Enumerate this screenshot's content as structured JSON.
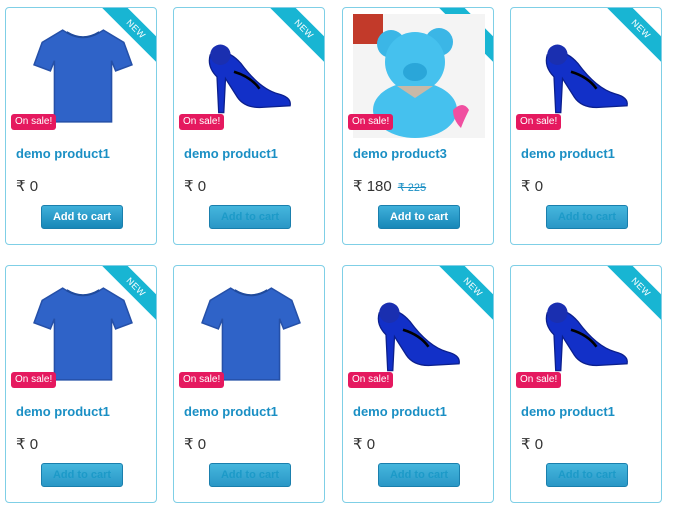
{
  "colors": {
    "accent": "#1a8fc4",
    "sale": "#e5195f",
    "ribbon": "#18b5d3",
    "border": "#7fcfe6"
  },
  "products": [
    {
      "name": "demo product1",
      "price": "₹ 0",
      "old_price": "",
      "badge": "On sale!",
      "ribbon": "NEW",
      "image": "tshirt-icon",
      "button": "Add to cart"
    },
    {
      "name": "demo product1",
      "price": "₹ 0",
      "old_price": "",
      "badge": "On sale!",
      "ribbon": "NEW",
      "image": "heel-icon",
      "button": "Add to cart"
    },
    {
      "name": "demo product3",
      "price": "₹ 180",
      "old_price": "₹ 225",
      "badge": "On sale!",
      "ribbon": "NEW",
      "image": "teddy-icon",
      "button": "Add to cart"
    },
    {
      "name": "demo product1",
      "price": "₹ 0",
      "old_price": "",
      "badge": "On sale!",
      "ribbon": "NEW",
      "image": "heel-icon",
      "button": "Add to cart"
    },
    {
      "name": "demo product1",
      "price": "₹ 0",
      "old_price": "",
      "badge": "On sale!",
      "ribbon": "NEW",
      "image": "tshirt-icon",
      "button": "Add to cart"
    },
    {
      "name": "demo product1",
      "price": "₹ 0",
      "old_price": "",
      "badge": "On sale!",
      "ribbon": "",
      "image": "tshirt-icon",
      "button": "Add to cart"
    },
    {
      "name": "demo product1",
      "price": "₹ 0",
      "old_price": "",
      "badge": "On sale!",
      "ribbon": "NEW",
      "image": "heel-icon",
      "button": "Add to cart"
    },
    {
      "name": "demo product1",
      "price": "₹ 0",
      "old_price": "",
      "badge": "On sale!",
      "ribbon": "NEW",
      "image": "heel-icon",
      "button": "Add to cart"
    }
  ]
}
